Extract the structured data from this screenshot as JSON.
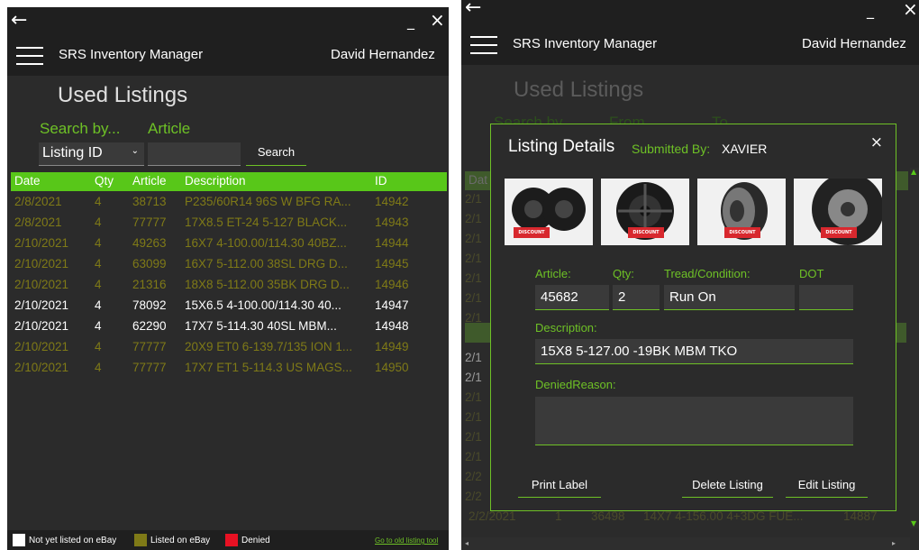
{
  "left": {
    "titlebar": {
      "back": "←",
      "minimize": "_",
      "close": "×"
    },
    "app_title": "SRS Inventory Manager",
    "user": "David Hernandez",
    "page_title": "Used Listings",
    "search": {
      "search_by_label": "Search by...",
      "article_label": "Article",
      "select_value": "Listing ID",
      "button": "Search"
    },
    "table": {
      "headers": [
        "Date",
        "Qty",
        "Article",
        "Description",
        "ID"
      ],
      "rows": [
        {
          "date": "2/8/2021",
          "qty": "4",
          "article": "38713",
          "desc": "P235/60R14 96S W BFG RA...",
          "id": "14942",
          "status": "listed"
        },
        {
          "date": "2/8/2021",
          "qty": "4",
          "article": "77777",
          "desc": "17X8.5 ET-24 5-127 BLACK...",
          "id": "14943",
          "status": "listed"
        },
        {
          "date": "2/10/2021",
          "qty": "4",
          "article": "49263",
          "desc": "16X7 4-100.00/114.30 40BZ...",
          "id": "14944",
          "status": "listed"
        },
        {
          "date": "2/10/2021",
          "qty": "4",
          "article": "63099",
          "desc": "16X7 5-112.00 38SL DRG D...",
          "id": "14945",
          "status": "listed"
        },
        {
          "date": "2/10/2021",
          "qty": "4",
          "article": "21316",
          "desc": "18X8 5-112.00 35BK DRG D...",
          "id": "14946",
          "status": "listed"
        },
        {
          "date": "2/10/2021",
          "qty": "4",
          "article": "78092",
          "desc": "15X6.5 4-100.00/114.30 40...",
          "id": "14947",
          "status": "notlisted"
        },
        {
          "date": "2/10/2021",
          "qty": "4",
          "article": "62290",
          "desc": "17X7 5-114.30 40SL MBM...",
          "id": "14948",
          "status": "notlisted"
        },
        {
          "date": "2/10/2021",
          "qty": "4",
          "article": "77777",
          "desc": "20X9 ET0 6-139.7/135 ION 1...",
          "id": "14949",
          "status": "listed"
        },
        {
          "date": "2/10/2021",
          "qty": "4",
          "article": "77777",
          "desc": "17X7 ET1 5-114.3 US MAGS...",
          "id": "14950",
          "status": "listed"
        }
      ]
    },
    "legend": {
      "not_listed": "Not yet listed on eBay",
      "listed": "Listed on eBay",
      "denied": "Denied",
      "old_tool": "Go to old listing tool"
    },
    "colors": {
      "header_green": "#58c719",
      "listed": "#7f7a17",
      "denied": "#e81123"
    }
  },
  "right": {
    "titlebar": {
      "back": "←",
      "minimize": "_",
      "close": "×"
    },
    "app_title": "SRS Inventory Manager",
    "user": "David Hernandez",
    "page_title": "Used Listings",
    "bg_search": {
      "search_by": "Search by",
      "from": "From",
      "to": "To"
    },
    "bg_header": "Dat",
    "bg_rows": [
      "2/1",
      "2/1",
      "2/1",
      "2/1",
      "2/1",
      "2/1",
      "2/1",
      "2/1",
      "2/1",
      "2/1",
      "2/1",
      "2/1",
      "2/1",
      "2/1",
      "2/2",
      "2/2"
    ],
    "bg_last_row": {
      "date": "2/2/2021",
      "qty": "1",
      "article": "36498",
      "desc": "14X7 4-156.00 4+3DG FUE...",
      "id": "14887"
    },
    "dialog": {
      "title": "Listing Details",
      "submitted_label": "Submitted By:",
      "submitted_value": "XAVIER",
      "close": "×",
      "thumb_tag": "DISCOUNT",
      "fields": {
        "article_label": "Article:",
        "article_value": "45682",
        "qty_label": "Qty:",
        "qty_value": "2",
        "tread_label": "Tread/Condition:",
        "tread_value": "Run On",
        "dot_label": "DOT",
        "dot_value": "",
        "desc_label": "Description:",
        "desc_value": "15X8  5-127.00 -19BK MBM TKO",
        "denied_label": "DeniedReason:",
        "denied_value": ""
      },
      "buttons": {
        "print": "Print Label",
        "delete": "Delete Listing",
        "edit": "Edit Listing"
      }
    }
  }
}
